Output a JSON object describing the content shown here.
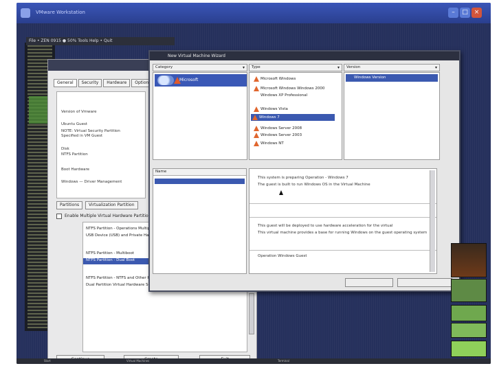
{
  "window": {
    "title": "VMware Workstation"
  },
  "menubar": {
    "text": "File • ZEN 0915 ● 50% Tools Help • Quit"
  },
  "back_window": {
    "tabs": [
      "General",
      "Security",
      "Hardware",
      "Options"
    ],
    "fields": [
      "Version of Vmware",
      "Ubuntu Guest",
      "NOTE: Virtual Security Partition",
      "Specified in VM Guest",
      "Disk",
      "NTFS Partition",
      "Boot Hardware",
      "Windows — Driver Management"
    ],
    "sub_tabs": [
      "Partitions",
      "Virtualization Partition"
    ],
    "checkbox_label": "Enable Multiple Virtual Hardware Partitions",
    "list_rows": [
      "NTFS Partition - Operations Multipartition",
      "USB Device (USB) and Private Hardware",
      "",
      "NTFS Partition - Multiboot",
      "NTFS Partition - Dual Boot",
      "",
      "NTFS Partition - NTFS and Other Partitions",
      "Dual Partition Virtual Hardware Security"
    ],
    "selected_row": 4,
    "buttons": [
      "Continue",
      "Create",
      "Exit"
    ]
  },
  "dialog": {
    "title": "New Virtual Machine Wizard",
    "col_headers": [
      "Category",
      "Type",
      "Version"
    ],
    "os_category": "Microsoft",
    "types": [
      "Microsoft Windows",
      "Microsoft Windows Windows 2000",
      "Windows XP Professional",
      "Windows Vista",
      "Windows 7",
      "Windows Server 2008",
      "Windows Server 2003",
      "Windows NT"
    ],
    "selected_type": 4,
    "version_selected": "Windows Version",
    "lower_left_header": "Name",
    "detail_lines": [
      "This system is preparing Operation - Windows 7",
      "The guest is built to run Windows OS in the Virtual Machine",
      "",
      "This guest will be deployed to use hardware acceleration for the virtual",
      "This virtual machine provides a base for running Windows on the guest operating system",
      "",
      "Operation Windows Guest"
    ]
  },
  "taskbar": {
    "items": [
      "Start",
      "Virtual Machines",
      "Terminal"
    ]
  }
}
